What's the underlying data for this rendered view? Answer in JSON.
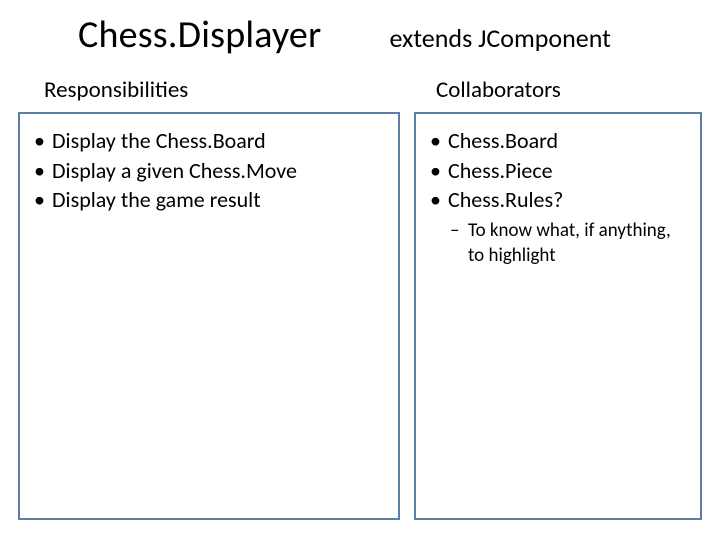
{
  "header": {
    "class_name": "Chess.Displayer",
    "extends_label": "extends JComponent"
  },
  "left": {
    "heading": "Responsibilities",
    "items": [
      "Display the Chess.Board",
      "Display a given Chess.Move",
      "Display the game result"
    ]
  },
  "right": {
    "heading": "Collaborators",
    "items": [
      "Chess.Board",
      "Chess.Piece",
      "Chess.Rules?"
    ],
    "subnote": "To know what, if anything, to highlight"
  }
}
